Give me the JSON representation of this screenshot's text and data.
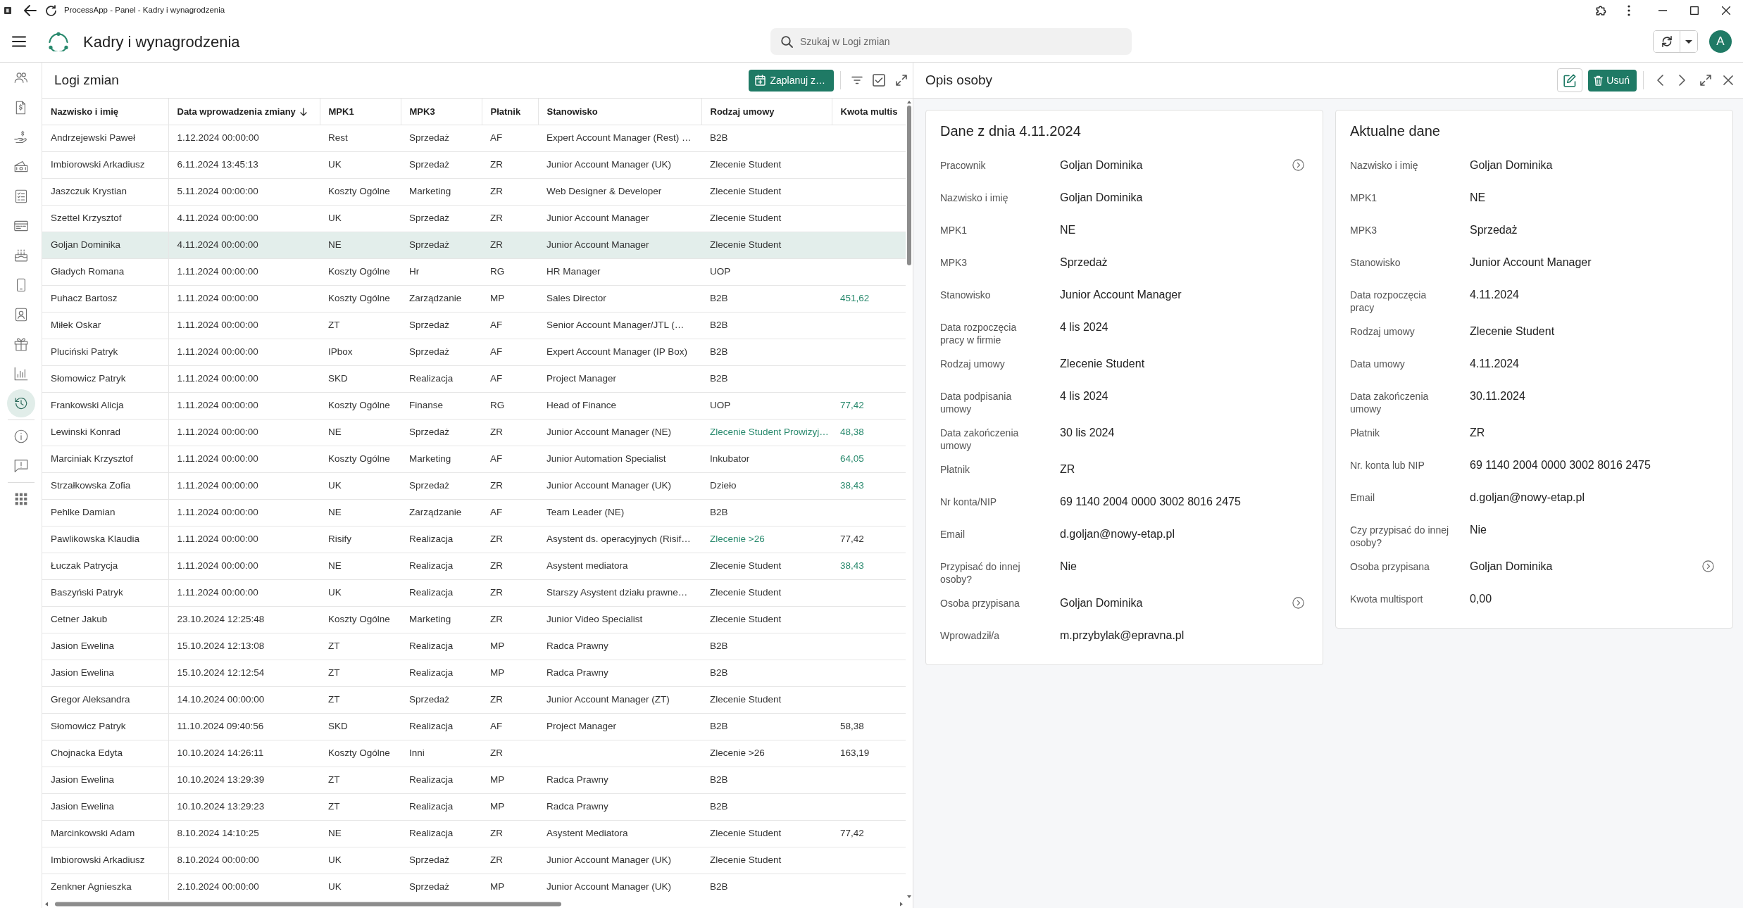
{
  "window": {
    "title": "ProcessApp - Panel - Kadry i wynagrodzenia"
  },
  "app_header": {
    "title": "Kadry i wynagrodzenia",
    "search": {
      "placeholder": "Szukaj w Logi zmian"
    },
    "avatar": {
      "initial": "A"
    }
  },
  "sidebar": {
    "groups": [
      {
        "items": [
          {
            "selected": false
          },
          {
            "selected": false
          },
          {
            "selected": false
          },
          {
            "selected": false
          },
          {
            "selected": false
          },
          {
            "selected": false
          },
          {
            "selected": false
          },
          {
            "selected": false
          },
          {
            "selected": false
          },
          {
            "selected": false
          },
          {
            "selected": false
          },
          {
            "selected": true
          }
        ]
      },
      {
        "items": [
          {
            "selected": false
          },
          {
            "selected": false
          }
        ]
      },
      {
        "items": [
          {
            "selected": false
          }
        ]
      }
    ]
  },
  "log_panel": {
    "title": "Logi zmian",
    "schedule_button": "Zaplanuj z…",
    "table": {
      "columns": [
        {
          "label": "Nazwisko i imię",
          "sorted": false
        },
        {
          "label": "Data wprowadzenia zmiany",
          "sorted": true
        },
        {
          "label": "MPK1",
          "sorted": false
        },
        {
          "label": "MPK3",
          "sorted": false
        },
        {
          "label": "Płatnik",
          "sorted": false
        },
        {
          "label": "Stanowisko",
          "sorted": false
        },
        {
          "label": "Rodzaj umowy",
          "sorted": false
        },
        {
          "label": "Kwota multis",
          "sorted": false
        }
      ],
      "rows": [
        {
          "selected": false,
          "name": "Andrzejewski Paweł",
          "entry_date": "1.12.2024 00:00:00",
          "mpk1": "Rest",
          "mpk3": "Sprzedaż",
          "payer": "AF",
          "position": "Expert Account Manager (Rest) …",
          "contract": {
            "value": "B2B",
            "highlighted": false
          }
        },
        {
          "selected": false,
          "name": "Imbiorowski Arkadiusz",
          "entry_date": "6.11.2024 13:45:13",
          "mpk1": "UK",
          "mpk3": "Sprzedaż",
          "payer": "ZR",
          "position": "Junior Account Manager (UK)",
          "contract": {
            "value": "Zlecenie Student",
            "highlighted": false
          }
        },
        {
          "selected": false,
          "name": "Jaszczuk Krystian",
          "entry_date": "5.11.2024 00:00:00",
          "mpk1": "Koszty Ogólne",
          "mpk3": "Marketing",
          "payer": "ZR",
          "position": "Web Designer & Developer",
          "contract": {
            "value": "Zlecenie Student",
            "highlighted": false
          }
        },
        {
          "selected": false,
          "name": "Szettel Krzysztof",
          "entry_date": "4.11.2024 00:00:00",
          "mpk1": "UK",
          "mpk3": "Sprzedaż",
          "payer": "ZR",
          "position": "Junior Account Manager",
          "contract": {
            "value": "Zlecenie Student",
            "highlighted": false
          }
        },
        {
          "selected": true,
          "name": "Goljan Dominika",
          "entry_date": "4.11.2024 00:00:00",
          "mpk1": "NE",
          "mpk3": "Sprzedaż",
          "payer": "ZR",
          "position": "Junior Account Manager",
          "contract": {
            "value": "Zlecenie Student",
            "highlighted": false
          }
        },
        {
          "selected": false,
          "name": "Gładych Romana",
          "entry_date": "1.11.2024 00:00:00",
          "mpk1": "Koszty Ogólne",
          "mpk3": "Hr",
          "payer": "RG",
          "position": "HR Manager",
          "contract": {
            "value": "UOP",
            "highlighted": false
          }
        },
        {
          "selected": false,
          "name": "Puhacz Bartosz",
          "entry_date": "1.11.2024 00:00:00",
          "mpk1": "Koszty Ogólne",
          "mpk3": "Zarządzanie",
          "payer": "MP",
          "position": "Sales Director",
          "contract": {
            "value": "B2B",
            "highlighted": false
          },
          "multisport": {
            "value": "451,62",
            "highlighted": true
          }
        },
        {
          "selected": false,
          "name": "Miłek Oskar",
          "entry_date": "1.11.2024 00:00:00",
          "mpk1": "ZT",
          "mpk3": "Sprzedaż",
          "payer": "AF",
          "position": "Senior Account Manager/JTL (…",
          "contract": {
            "value": "B2B",
            "highlighted": false
          }
        },
        {
          "selected": false,
          "name": "Pluciński Patryk",
          "entry_date": "1.11.2024 00:00:00",
          "mpk1": "IPbox",
          "mpk3": "Sprzedaż",
          "payer": "AF",
          "position": "Expert Account Manager (IP Box)",
          "contract": {
            "value": "B2B",
            "highlighted": false
          }
        },
        {
          "selected": false,
          "name": "Słomowicz Patryk",
          "entry_date": "1.11.2024 00:00:00",
          "mpk1": "SKD",
          "mpk3": "Realizacja",
          "payer": "AF",
          "position": "Project Manager",
          "contract": {
            "value": "B2B",
            "highlighted": false
          }
        },
        {
          "selected": false,
          "name": "Frankowski Alicja",
          "entry_date": "1.11.2024 00:00:00",
          "mpk1": "Koszty Ogólne",
          "mpk3": "Finanse",
          "payer": "RG",
          "position": "Head of Finance",
          "contract": {
            "value": "UOP",
            "highlighted": false
          },
          "multisport": {
            "value": "77,42",
            "highlighted": true
          }
        },
        {
          "selected": false,
          "name": "Lewinski Konrad",
          "entry_date": "1.11.2024 00:00:00",
          "mpk1": "NE",
          "mpk3": "Sprzedaż",
          "payer": "ZR",
          "position": "Junior Account Manager (NE)",
          "contract": {
            "value": "Zlecenie Student Prowizyj…",
            "highlighted": true
          },
          "multisport": {
            "value": "48,38",
            "highlighted": true
          }
        },
        {
          "selected": false,
          "name": "Marciniak Krzysztof",
          "entry_date": "1.11.2024 00:00:00",
          "mpk1": "Koszty Ogólne",
          "mpk3": "Marketing",
          "payer": "AF",
          "position": "Junior Automation Specialist",
          "contract": {
            "value": "Inkubator",
            "highlighted": false
          },
          "multisport": {
            "value": "64,05",
            "highlighted": true
          }
        },
        {
          "selected": false,
          "name": "Strzałkowska Zofia",
          "entry_date": "1.11.2024 00:00:00",
          "mpk1": "UK",
          "mpk3": "Sprzedaż",
          "payer": "ZR",
          "position": "Junior Account Manager (UK)",
          "contract": {
            "value": "Dzieło",
            "highlighted": false
          },
          "multisport": {
            "value": "38,43",
            "highlighted": true
          }
        },
        {
          "selected": false,
          "name": "Pehlke Damian",
          "entry_date": "1.11.2024 00:00:00",
          "mpk1": "NE",
          "mpk3": "Zarządzanie",
          "payer": "AF",
          "position": "Team Leader (NE)",
          "contract": {
            "value": "B2B",
            "highlighted": false
          }
        },
        {
          "selected": false,
          "name": "Pawlikowska Klaudia",
          "entry_date": "1.11.2024 00:00:00",
          "mpk1": "Risify",
          "mpk3": "Realizacja",
          "payer": "ZR",
          "position": "Asystent ds. operacyjnych (Risif…",
          "contract": {
            "value": "Zlecenie >26",
            "highlighted": true
          },
          "multisport": {
            "value": "77,42",
            "highlighted": false
          }
        },
        {
          "selected": false,
          "name": "Łuczak Patrycja",
          "entry_date": "1.11.2024 00:00:00",
          "mpk1": "NE",
          "mpk3": "Realizacja",
          "payer": "ZR",
          "position": "Asystent mediatora",
          "contract": {
            "value": "Zlecenie Student",
            "highlighted": false
          },
          "multisport": {
            "value": "38,43",
            "highlighted": true
          }
        },
        {
          "selected": false,
          "name": "Baszyński Patryk",
          "entry_date": "1.11.2024 00:00:00",
          "mpk1": "UK",
          "mpk3": "Realizacja",
          "payer": "ZR",
          "position": "Starszy Asystent działu prawne…",
          "contract": {
            "value": "Zlecenie Student",
            "highlighted": false
          }
        },
        {
          "selected": false,
          "name": "Cetner Jakub",
          "entry_date": "23.10.2024 12:25:48",
          "mpk1": "Koszty Ogólne",
          "mpk3": "Marketing",
          "payer": "ZR",
          "position": "Junior Video Specialist",
          "contract": {
            "value": "Zlecenie Student",
            "highlighted": false
          }
        },
        {
          "selected": false,
          "name": "Jasion Ewelina",
          "entry_date": "15.10.2024 12:13:08",
          "mpk1": "ZT",
          "mpk3": "Realizacja",
          "payer": "MP",
          "position": "Radca Prawny",
          "contract": {
            "value": "B2B",
            "highlighted": false
          }
        },
        {
          "selected": false,
          "name": "Jasion Ewelina",
          "entry_date": "15.10.2024 12:12:54",
          "mpk1": "ZT",
          "mpk3": "Realizacja",
          "payer": "MP",
          "position": "Radca Prawny",
          "contract": {
            "value": "B2B",
            "highlighted": false
          }
        },
        {
          "selected": false,
          "name": "Gregor Aleksandra",
          "entry_date": "14.10.2024 00:00:00",
          "mpk1": "ZT",
          "mpk3": "Sprzedaż",
          "payer": "ZR",
          "position": "Junior Account Manager (ZT)",
          "contract": {
            "value": "Zlecenie Student",
            "highlighted": false
          }
        },
        {
          "selected": false,
          "name": "Słomowicz Patryk",
          "entry_date": "11.10.2024 09:40:56",
          "mpk1": "SKD",
          "mpk3": "Realizacja",
          "payer": "AF",
          "position": "Project Manager",
          "contract": {
            "value": "B2B",
            "highlighted": false
          },
          "multisport": {
            "value": "58,38",
            "highlighted": false
          }
        },
        {
          "selected": false,
          "name": "Chojnacka Edyta",
          "entry_date": "10.10.2024 14:26:11",
          "mpk1": "Koszty Ogólne",
          "mpk3": "Inni",
          "payer": "ZR",
          "contract": {
            "value": "Zlecenie >26",
            "highlighted": false
          },
          "multisport": {
            "value": "163,19",
            "highlighted": false
          }
        },
        {
          "selected": false,
          "name": "Jasion Ewelina",
          "entry_date": "10.10.2024 13:29:39",
          "mpk1": "ZT",
          "mpk3": "Realizacja",
          "payer": "MP",
          "position": "Radca Prawny",
          "contract": {
            "value": "B2B",
            "highlighted": false
          }
        },
        {
          "selected": false,
          "name": "Jasion Ewelina",
          "entry_date": "10.10.2024 13:29:23",
          "mpk1": "ZT",
          "mpk3": "Realizacja",
          "payer": "MP",
          "position": "Radca Prawny",
          "contract": {
            "value": "B2B",
            "highlighted": false
          }
        },
        {
          "selected": false,
          "name": "Marcinkowski Adam",
          "entry_date": "8.10.2024 14:10:25",
          "mpk1": "NE",
          "mpk3": "Realizacja",
          "payer": "ZR",
          "position": "Asystent Mediatora",
          "contract": {
            "value": "Zlecenie Student",
            "highlighted": false
          },
          "multisport": {
            "value": "77,42",
            "highlighted": false
          }
        },
        {
          "selected": false,
          "name": "Imbiorowski Arkadiusz",
          "entry_date": "8.10.2024 00:00:00",
          "mpk1": "UK",
          "mpk3": "Sprzedaż",
          "payer": "ZR",
          "position": "Junior Account Manager (UK)",
          "contract": {
            "value": "Zlecenie Student",
            "highlighted": false
          }
        },
        {
          "selected": false,
          "name": "Zenkner Agnieszka",
          "entry_date": "2.10.2024 00:00:00",
          "mpk1": "UK",
          "mpk3": "Sprzedaż",
          "payer": "MP",
          "position": "Junior Account Manager (UK)",
          "contract": {
            "value": "B2B",
            "highlighted": false
          }
        }
      ]
    }
  },
  "detail_panel": {
    "title": "Opis osoby",
    "delete_button": "Usuń",
    "cards": [
      {
        "title": "Dane z dnia 4.11.2024",
        "fields": [
          {
            "label": "Pracownik",
            "value": "Goljan Dominika",
            "navigable": true
          },
          {
            "label": "Nazwisko i imię",
            "value": "Goljan Dominika",
            "navigable": false
          },
          {
            "label": "MPK1",
            "value": "NE",
            "navigable": false
          },
          {
            "label": "MPK3",
            "value": "Sprzedaż",
            "navigable": false
          },
          {
            "label": "Stanowisko",
            "value": "Junior Account Manager",
            "navigable": false
          },
          {
            "label": "Data rozpoczęcia\npracy w firmie",
            "value": "4 lis 2024",
            "navigable": false
          },
          {
            "label": "Rodzaj umowy",
            "value": "Zlecenie Student",
            "navigable": false
          },
          {
            "label": "Data podpisania\numowy",
            "value": "4 lis 2024",
            "navigable": false
          },
          {
            "label": "Data zakończenia\numowy",
            "value": "30 lis 2024",
            "navigable": false
          },
          {
            "label": "Płatnik",
            "value": "ZR",
            "navigable": false
          },
          {
            "label": "Nr konta/NIP",
            "value": "69 1140 2004 0000 3002 8016 2475",
            "navigable": false
          },
          {
            "label": "Email",
            "value": "d.goljan@nowy-etap.pl",
            "navigable": false
          },
          {
            "label": "Przypisać do innej\nosoby?",
            "value": "Nie",
            "navigable": false
          },
          {
            "label": "Osoba przypisana",
            "value": "Goljan Dominika",
            "navigable": true
          },
          {
            "label": "Wprowadził/a",
            "value": "m.przybylak@epravna.pl",
            "navigable": false
          }
        ]
      },
      {
        "title": "Aktualne dane",
        "fields": [
          {
            "label": "Nazwisko i imię",
            "value": "Goljan Dominika",
            "navigable": false
          },
          {
            "label": "MPK1",
            "value": "NE",
            "navigable": false
          },
          {
            "label": "MPK3",
            "value": "Sprzedaż",
            "navigable": false
          },
          {
            "label": "Stanowisko",
            "value": "Junior Account Manager",
            "navigable": false
          },
          {
            "label": "Data rozpoczęcia\npracy",
            "value": "4.11.2024",
            "navigable": false
          },
          {
            "label": "Rodzaj umowy",
            "value": "Zlecenie Student",
            "navigable": false
          },
          {
            "label": "Data umowy",
            "value": "4.11.2024",
            "navigable": false
          },
          {
            "label": "Data zakończenia\numowy",
            "value": "30.11.2024",
            "navigable": false
          },
          {
            "label": "Płatnik",
            "value": "ZR",
            "navigable": false
          },
          {
            "label": "Nr. konta lub NIP",
            "value": "69 1140 2004 0000 3002 8016 2475",
            "navigable": false
          },
          {
            "label": "Email",
            "value": "d.goljan@nowy-etap.pl",
            "navigable": false
          },
          {
            "label": "Czy przypisać do innej\nosoby?",
            "value": "Nie",
            "navigable": false
          },
          {
            "label": "Osoba przypisana",
            "value": "Goljan Dominika",
            "navigable": true
          },
          {
            "label": "Kwota multisport",
            "value": "0,00",
            "navigable": false
          }
        ]
      }
    ]
  }
}
